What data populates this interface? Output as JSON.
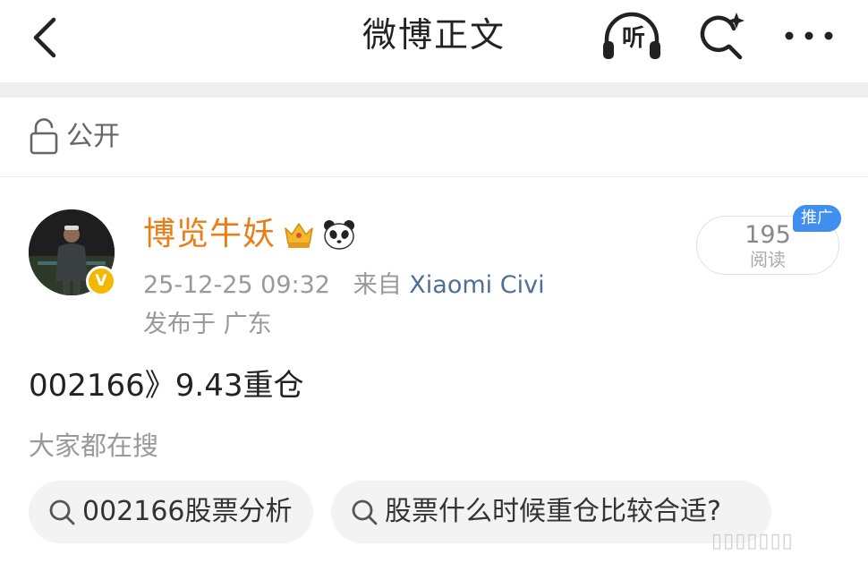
{
  "header": {
    "title": "微博正文",
    "listen_label": "听"
  },
  "privacy": {
    "label": "公开"
  },
  "post": {
    "author": "博览牛妖",
    "time": "25-12-25 09:32",
    "from_prefix": "来自",
    "source": "Xiaomi Civi",
    "location": "发布于 广东",
    "read_count": "195",
    "read_label": "阅读",
    "promo_badge": "推广",
    "text": "002166》9.43重仓",
    "verified_badge": "V"
  },
  "related_search": {
    "title": "大家都在搜",
    "chips": [
      {
        "label": "002166股票分析"
      },
      {
        "label": "股票什么时候重仓比较合适?"
      }
    ]
  },
  "watermark": "▯▯▯▯▯▯▯",
  "icons": {
    "back": "chevron-left-icon",
    "listen": "headphones-icon",
    "search": "magnifier-sparkle-icon",
    "more": "more-dots-icon",
    "lock": "unlock-icon",
    "crown": "crown-icon",
    "panda": "panda-icon",
    "chip_search": "search-icon"
  },
  "colors": {
    "username": "#eb7d14",
    "source_link": "#4d6f96",
    "promo_badge": "#3f8ef0",
    "verified": "#f5b800"
  }
}
